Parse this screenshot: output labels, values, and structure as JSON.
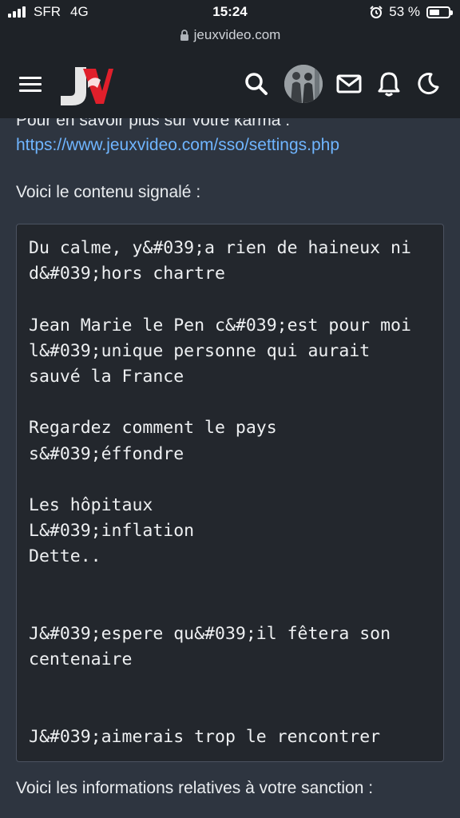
{
  "status_bar": {
    "carrier": "SFR",
    "network": "4G",
    "time": "15:24",
    "battery": "53 %",
    "battery_level": 0.53
  },
  "browser": {
    "url": "jeuxvideo.com"
  },
  "header": {
    "logo_text": "JV",
    "icons": [
      "menu-icon",
      "search-icon",
      "avatar",
      "mail-icon",
      "bell-icon",
      "moon-icon"
    ]
  },
  "colors": {
    "background": "#2e3540",
    "header": "#1e2227",
    "link": "#6fb5ff",
    "logo_red": "#e01f2b"
  },
  "content": {
    "karma_partial": "Pour en savoir plus sur votre karma :",
    "karma_link": "https://www.jeuxvideo.com/sso/settings.php",
    "reported_intro": "Voici le contenu signalé :",
    "reported_text": "Du calme, y&#039;a rien de haineux ni d&#039;hors chartre\n\nJean Marie le Pen c&#039;est pour moi l&#039;unique personne qui aurait sauvé la France\n\nRegardez comment le pays s&#039;éffondre\n\nLes hôpitaux\nL&#039;inflation\nDette..\n\n\nJ&#039;espere qu&#039;il fêtera son centenaire\n\n\nJ&#039;aimerais trop le rencontrer",
    "sanction_intro": "Voici les informations relatives à votre sanction :"
  }
}
